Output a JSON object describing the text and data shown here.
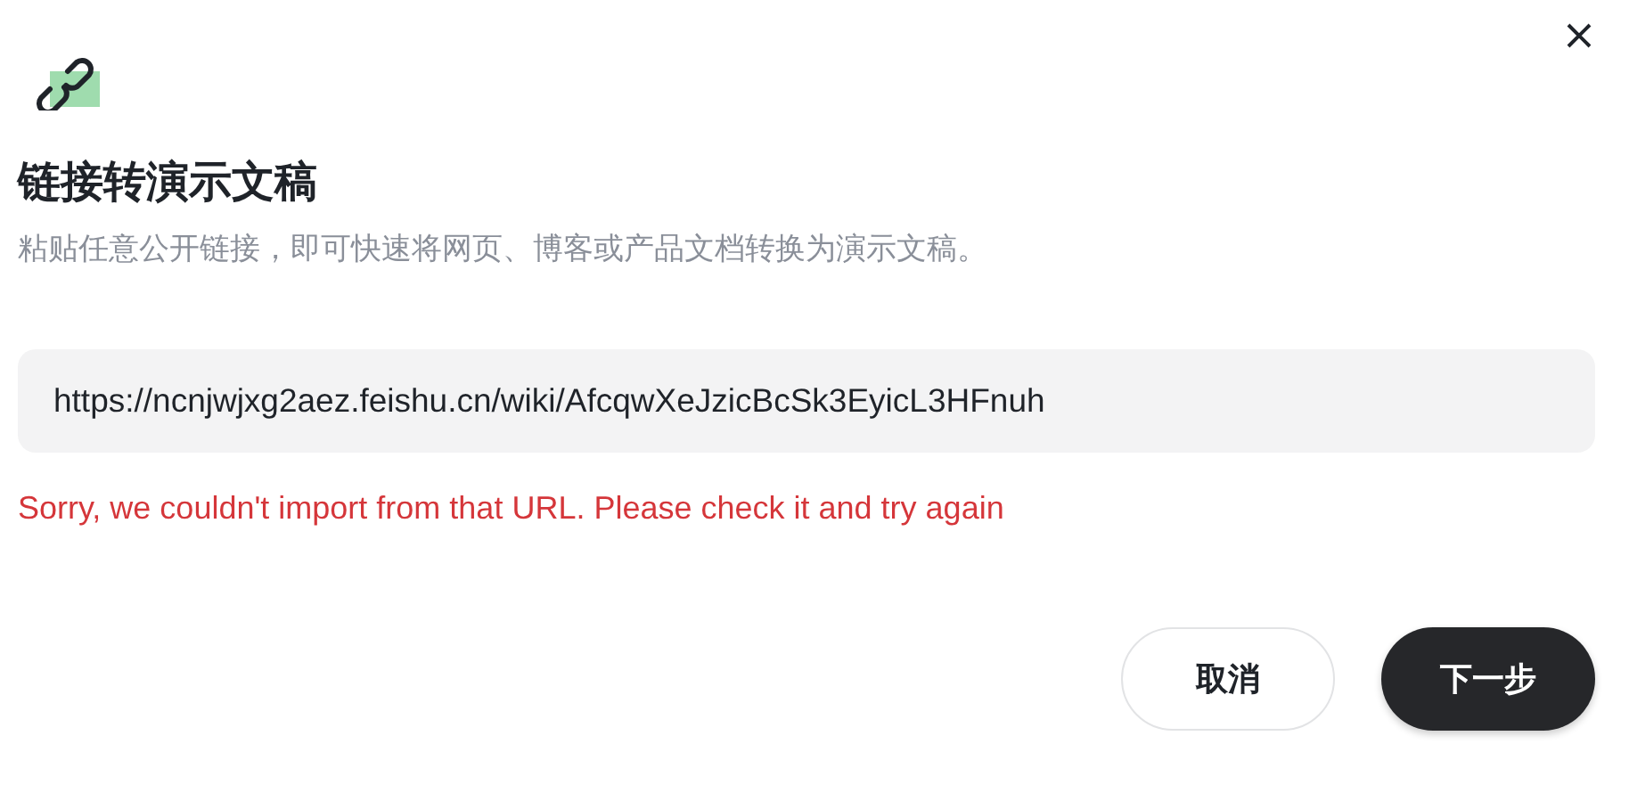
{
  "dialog": {
    "title": "链接转演示文稿",
    "description": "粘贴任意公开链接，即可快速将网页、博客或产品文档转换为演示文稿。"
  },
  "url_field": {
    "value": "https://ncnjwjxg2aez.feishu.cn/wiki/AfcqwXeJzicBcSk3EyicL3HFnuh"
  },
  "error": "Sorry, we couldn't import from that URL. Please check it and try again",
  "buttons": [
    {
      "label": "取消",
      "kind": "secondary"
    },
    {
      "label": "下一步",
      "kind": "primary"
    }
  ]
}
